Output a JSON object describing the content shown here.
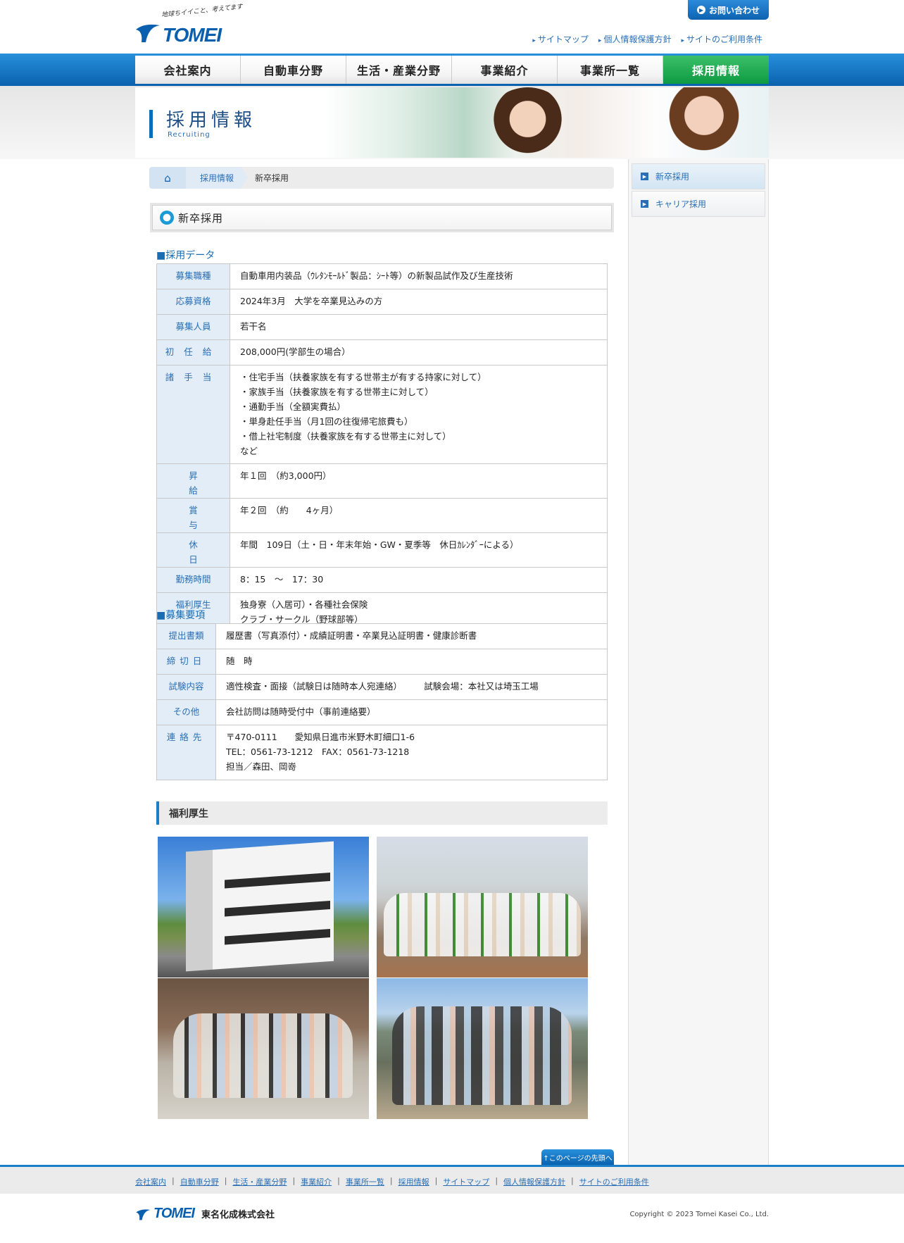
{
  "header": {
    "logo_tagline": "地球ちイイこと、考えてます",
    "logo_word": "TOMEI",
    "contact_label": "お問い合わせ",
    "util_links": [
      "サイトマップ",
      "個人情報保護方針",
      "サイトのご利用条件"
    ]
  },
  "nav": {
    "items": [
      "会社案内",
      "自動車分野",
      "生活・産業分野",
      "事業紹介",
      "事業所一覧",
      "採用情報"
    ],
    "active": "採用情報"
  },
  "banner": {
    "title": "採用情報",
    "subtitle": "Recruiting"
  },
  "breadcrumb": {
    "link": "採用情報",
    "current": "新卒採用"
  },
  "sidebar": {
    "items": [
      "新卒採用",
      "キャリア採用"
    ],
    "active": "新卒採用"
  },
  "section_title": "新卒採用",
  "recruit_data": {
    "heading": "■採用データ",
    "rows": [
      {
        "key": "募集職種",
        "value": "自動車用内装品（ｳﾚﾀﾝﾓｰﾙﾄﾞ製品：ｼｰﾄ等）の新製品試作及び生産技術"
      },
      {
        "key": "応募資格",
        "value": "2024年3月　大学を卒業見込みの方"
      },
      {
        "key": "募集人員",
        "value": "若干名"
      },
      {
        "key": "初任給",
        "value": " 208,000円(学部生の場合）"
      },
      {
        "key": "諸手当",
        "lines": [
          "・住宅手当（扶養家族を有する世帯主が有する持家に対して）",
          "・家族手当（扶養家族を有する世帯主に対して）",
          "・通勤手当（全額実費払）",
          "・単身赴任手当（月1回の往復帰宅旅費も）",
          "・借上社宅制度（扶養家族を有する世帯主に対して）",
          "など"
        ]
      },
      {
        "key": "昇給",
        "value": "年１回　（約3,000円）"
      },
      {
        "key": "賞与",
        "value": "年２回　（約　　4ヶ月）"
      },
      {
        "key": "休日",
        "value": "年間　109日（土・日・年末年始・GW・夏季等　休日ｶﾚﾝﾀﾞｰによる）"
      },
      {
        "key": "勤務時間",
        "value": "8：15　～　17：30"
      },
      {
        "key": "福利厚生",
        "lines": [
          "独身寮（入居可）・各種社会保険",
          "クラブ・サークル（野球部等）"
        ]
      }
    ]
  },
  "requirements": {
    "heading": "■募集要項",
    "rows": [
      {
        "key": "提出書類",
        "value": "履歴書（写真添付）・成績証明書・卒業見込証明書・健康診断書"
      },
      {
        "key": "締切日",
        "value": "随　時"
      },
      {
        "key": "試験内容",
        "value": "適性検査・面接（試験日は随時本人宛連絡）　　　試験会場：本社又は埼玉工場"
      },
      {
        "key": "その他",
        "value": "会社訪問は随時受付中（事前連絡要）"
      },
      {
        "key": "連絡先",
        "lines": [
          "〒470-0111　　愛知県日進市米野木町細口1-6",
          "TEL：0561-73-1212　FAX：0561-73-1218",
          "担当／森田、岡嵜"
        ]
      }
    ]
  },
  "welfare_heading": "福利厚生",
  "to_top": "↑このページの先頭へ",
  "footer": {
    "links": [
      "会社案内",
      "自動車分野",
      "生活・産業分野",
      "事業紹介",
      "事業所一覧",
      "採用情報",
      "サイトマップ",
      "個人情報保護方針",
      "サイトのご利用条件"
    ],
    "company": "東名化成株式会社",
    "logo_word": "TOMEI",
    "copyright": "Copyright © 2023 Tomei Kasei Co., Ltd."
  },
  "colors": {
    "brand_blue": "#0a62ae",
    "active_green": "#0d9a43",
    "label_bg": "#e3edf7"
  }
}
